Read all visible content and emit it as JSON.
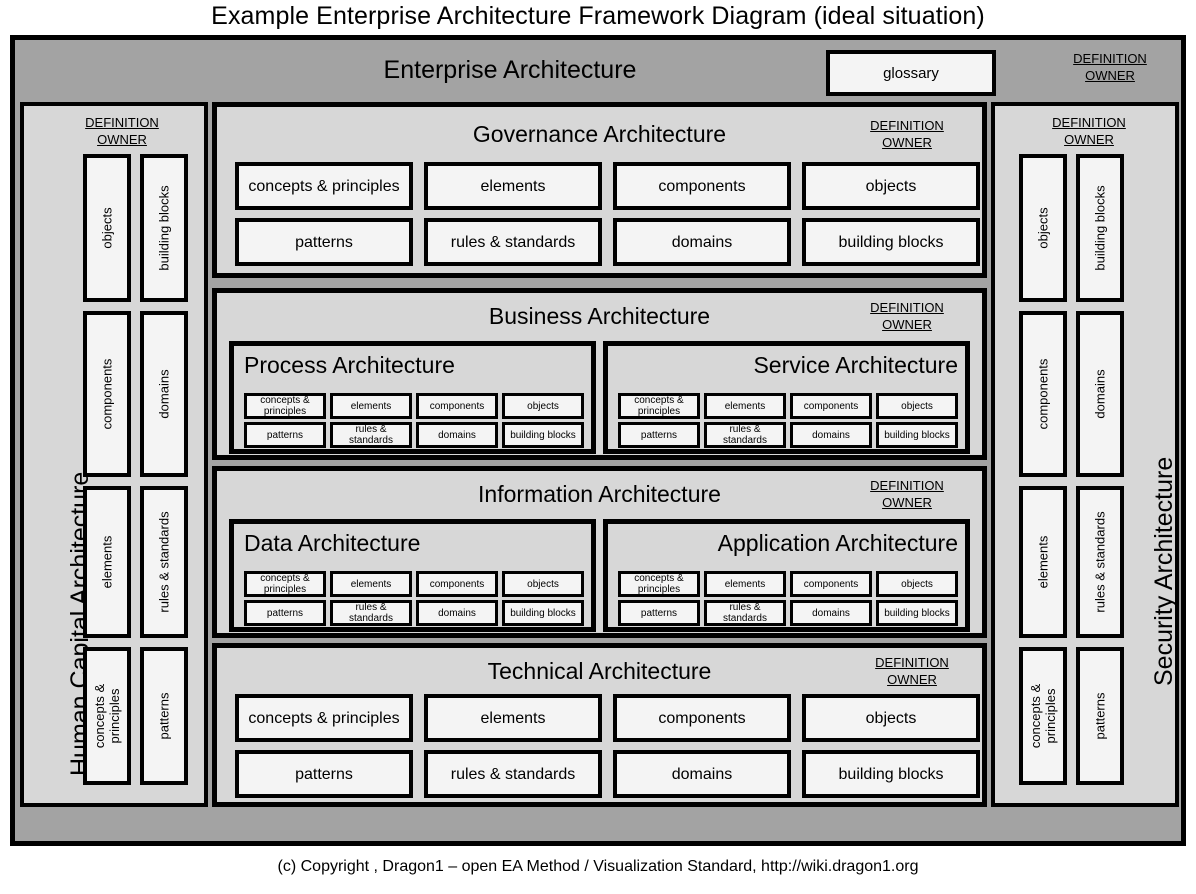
{
  "title": "Example Enterprise Architecture  Framework  Diagram (ideal situation)",
  "footer": "(c) Copyright , Dragon1 – open EA Method / Visualization  Standard, http://wiki.dragon1.org",
  "labels": {
    "definition": "DEFINITION",
    "owner": "OWNER"
  },
  "colors": {
    "outer_frame": "#a3a3a3",
    "panel": "#d7d7d7",
    "box": "#f4f4f4",
    "border": "#000000",
    "text": "#000000"
  },
  "enterprise": {
    "title": "Enterprise Architecture",
    "glossary": "glossary"
  },
  "aspects": {
    "row1": [
      "concepts & principles",
      "elements",
      "components",
      "objects"
    ],
    "row2": [
      "patterns",
      "rules & standards",
      "domains",
      "building blocks"
    ]
  },
  "aspects_small": {
    "row1": [
      "concepts & principles",
      "elements",
      "components",
      "objects"
    ],
    "row2": [
      "patterns",
      "rules & standards",
      "domains",
      "building blocks"
    ]
  },
  "left_panel": {
    "title": "Human Capital Architecture",
    "column_a": [
      "objects",
      "components",
      "elements",
      "concepts & principles"
    ],
    "column_b": [
      "building blocks",
      "domains",
      "rules & standards",
      "patterns"
    ]
  },
  "right_panel": {
    "title": "Security Architecture",
    "column_a": [
      "objects",
      "components",
      "elements",
      "concepts & principles"
    ],
    "column_b": [
      "building blocks",
      "domains",
      "rules & standards",
      "patterns"
    ]
  },
  "panels": [
    {
      "id": "governance",
      "title": "Governance Architecture"
    },
    {
      "id": "business",
      "title": "Business Architecture"
    },
    {
      "id": "information",
      "title": "Information Architecture"
    },
    {
      "id": "technical",
      "title": "Technical Architecture"
    }
  ],
  "subpanels": [
    {
      "id": "process",
      "title": "Process Architecture",
      "align": "left"
    },
    {
      "id": "service",
      "title": "Service Architecture",
      "align": "right"
    },
    {
      "id": "data",
      "title": "Data Architecture",
      "align": "left"
    },
    {
      "id": "application",
      "title": "Application Architecture",
      "align": "right"
    }
  ]
}
